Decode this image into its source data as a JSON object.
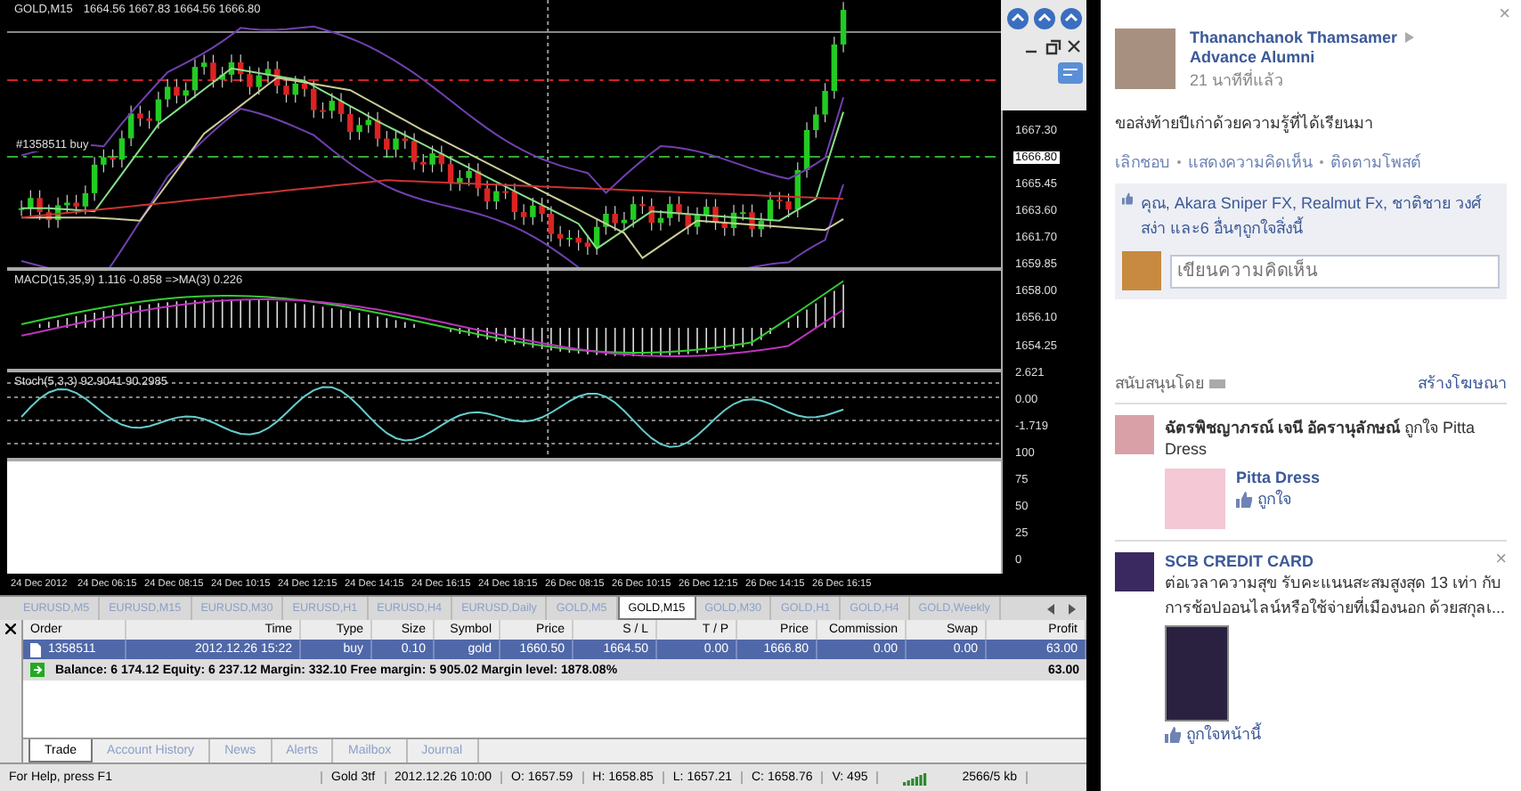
{
  "chart": {
    "symbol": "GOLD,M15",
    "ohlc": "1664.56 1667.83 1664.56 1666.80",
    "order_line": "#1358511 buy",
    "macd_label": "MACD(15,35,9) 1.116 -0.858 =>MA(3) 0.226",
    "stoch_label": "Stoch(5,3,3) 92.9041 90.2985",
    "axis_labels": [
      {
        "text": "1667.30",
        "highlighted": false
      },
      {
        "text": "1666.80",
        "highlighted": true
      },
      {
        "text": "1665.45",
        "highlighted": false
      },
      {
        "text": "1663.60",
        "highlighted": false
      },
      {
        "text": "1661.70",
        "highlighted": false
      },
      {
        "text": "1659.85",
        "highlighted": false
      },
      {
        "text": "1658.00",
        "highlighted": false
      },
      {
        "text": "1656.10",
        "highlighted": false
      },
      {
        "text": "1654.25",
        "highlighted": false
      },
      {
        "text": "2.621",
        "highlighted": false
      },
      {
        "text": "0.00",
        "highlighted": false
      },
      {
        "text": "-1.719",
        "highlighted": false
      },
      {
        "text": "100",
        "highlighted": false
      },
      {
        "text": "75",
        "highlighted": false
      },
      {
        "text": "50",
        "highlighted": false
      },
      {
        "text": "25",
        "highlighted": false
      },
      {
        "text": "0",
        "highlighted": false
      }
    ],
    "time_axis": [
      "24 Dec 2012",
      "24 Dec 06:15",
      "24 Dec 08:15",
      "24 Dec 10:15",
      "24 Dec 12:15",
      "24 Dec 14:15",
      "24 Dec 16:15",
      "24 Dec 18:15",
      "26 Dec 08:15",
      "26 Dec 10:15",
      "26 Dec 12:15",
      "26 Dec 14:15",
      "26 Dec 16:15"
    ]
  },
  "symbol_tabs": [
    {
      "label": "EURUSD,M5",
      "selected": false
    },
    {
      "label": "EURUSD,M15",
      "selected": false
    },
    {
      "label": "EURUSD,M30",
      "selected": false
    },
    {
      "label": "EURUSD,H1",
      "selected": false
    },
    {
      "label": "EURUSD,H4",
      "selected": false
    },
    {
      "label": "EURUSD,Daily",
      "selected": false
    },
    {
      "label": "GOLD,M5",
      "selected": false
    },
    {
      "label": "GOLD,M15",
      "selected": true
    },
    {
      "label": "GOLD,M30",
      "selected": false
    },
    {
      "label": "GOLD,H1",
      "selected": false
    },
    {
      "label": "GOLD,H4",
      "selected": false
    },
    {
      "label": "GOLD,Weekly",
      "selected": false
    }
  ],
  "terminal": {
    "columns": [
      "Order",
      "Time",
      "Type",
      "Size",
      "Symbol",
      "Price",
      "S / L",
      "T / P",
      "Price",
      "Commission",
      "Swap",
      "Profit"
    ],
    "rows": [
      {
        "cells": [
          "1358511",
          "2012.12.26 15:22",
          "buy",
          "0.10",
          "gold",
          "1660.50",
          "1664.50",
          "0.00",
          "1666.80",
          "0.00",
          "0.00",
          "63.00"
        ],
        "selected": true
      }
    ],
    "balance": "Balance: 6 174.12  Equity: 6 237.12  Margin: 332.10  Free margin: 5 905.02  Margin level: 1878.08%",
    "balance_profit": "63.00",
    "tabs": [
      {
        "label": "Trade",
        "selected": true
      },
      {
        "label": "Account History",
        "selected": false
      },
      {
        "label": "News",
        "selected": false
      },
      {
        "label": "Alerts",
        "selected": false
      },
      {
        "label": "Mailbox",
        "selected": false
      },
      {
        "label": "Journal",
        "selected": false
      }
    ]
  },
  "status_bar": [
    "For Help, press F1",
    "Gold 3tf",
    "2012.12.26 10:00",
    "O: 1657.59",
    "H: 1658.85",
    "L: 1657.21",
    "C: 1658.76",
    "V: 495",
    "2566/5 kb"
  ],
  "post": {
    "close": "×",
    "author": "Thananchanok Thamsamer",
    "group": "Advance Alumni",
    "time": "21 นาทีที่แล้ว",
    "text": "ขอส่งท้ายปีเก่าด้วยความรู้ที่ได้เรียนมา",
    "actions": [
      "เลิกชอบ",
      "แสดงความคิดเห็น",
      "ติดตามโพสต์"
    ],
    "likes": "คุณ, Akara Sniper FX, Realmut Fx, ชาติชาย วงศ์สง่า และ6 อื่นๆถูกใจสิ่งนี้",
    "comment_placeholder": "เขียนความคิดเห็น"
  },
  "sponsored": {
    "title": "สนับสนุนโดย",
    "create_ad": "สร้างโฆษณา",
    "ads": [
      {
        "kind": "page",
        "story": "**ฉัตรพิชญาภรณ์ เจนี อัครานุลักษณ์** ถูกใจ Pitta Dress",
        "page": "Pitta Dress",
        "like": "ถูกใจ"
      },
      {
        "kind": "promo",
        "title": "SCB CREDIT CARD",
        "close": "×",
        "text": "ต่อเวลาความสุข รับคะแนนสะสมสูงสุด 13 เท่า กับการช้อปออนไลน์หรือใช้จ่ายที่เมืองนอก ด้วยสกุลเ...",
        "like": "ถูกใจหน้านี้"
      }
    ]
  }
}
